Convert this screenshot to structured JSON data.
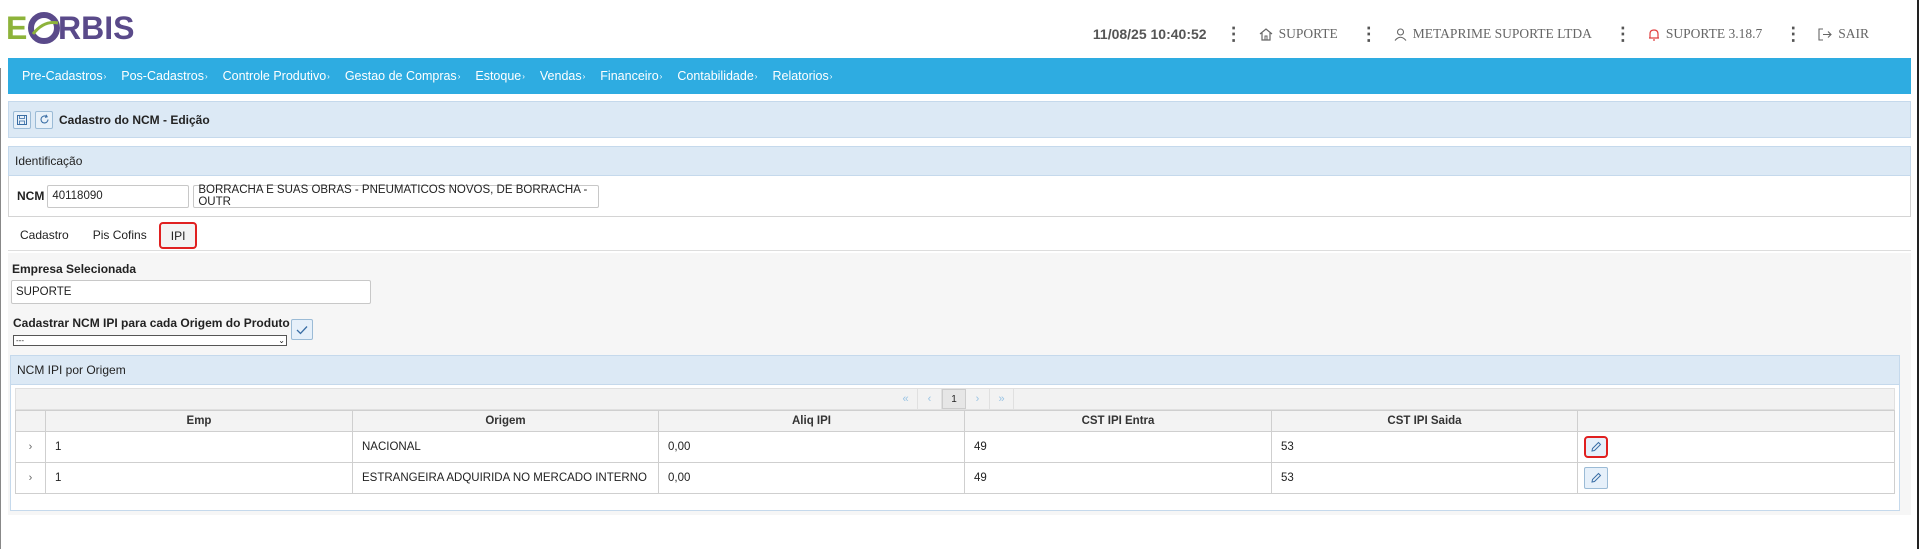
{
  "app": {
    "logo_text": "EORBIS",
    "colors": {
      "nav": "#2eace1",
      "panel_head": "#dce9f5",
      "highlight": "#e02020",
      "logo_green": "#8db33a",
      "logo_purple": "#5a4a8a"
    }
  },
  "header": {
    "datetime": "11/08/25 10:40:52",
    "company_short": "SUPORTE",
    "company_name": "METAPRIME SUPORTE LTDA",
    "version": "SUPORTE 3.18.7",
    "logout": "SAIR",
    "icons": [
      "home-icon",
      "user-icon",
      "bell-icon",
      "logout-icon"
    ]
  },
  "nav": {
    "items": [
      {
        "label": "Pre-Cadastros"
      },
      {
        "label": "Pos-Cadastros"
      },
      {
        "label": "Controle Produtivo"
      },
      {
        "label": "Gestao de Compras"
      },
      {
        "label": "Estoque"
      },
      {
        "label": "Vendas"
      },
      {
        "label": "Financeiro"
      },
      {
        "label": "Contabilidade"
      },
      {
        "label": "Relatorios"
      }
    ]
  },
  "edit": {
    "title": "Cadastro do NCM - Edição",
    "icons": [
      "save-icon",
      "refresh-icon"
    ]
  },
  "identificacao": {
    "title": "Identificação",
    "ncm_label": "NCM",
    "ncm_code": "40118090",
    "ncm_desc": "BORRACHA E SUAS OBRAS - PNEUMATICOS NOVOS, DE BORRACHA - OUTR"
  },
  "tabs": [
    {
      "label": "Cadastro",
      "active": false
    },
    {
      "label": "Pis Cofins",
      "active": false
    },
    {
      "label": "IPI",
      "active": true
    }
  ],
  "ipi": {
    "empresa_label": "Empresa Selecionada",
    "empresa_value": "SUPORTE",
    "cadastrar_label": "Cadastrar NCM IPI para cada Origem do Produto",
    "select_value": "---",
    "panel_title": "NCM IPI por Origem",
    "pager": {
      "first": "«",
      "prev": "‹",
      "page": "1",
      "next": "›",
      "last": "»"
    },
    "columns": [
      "Emp",
      "Origem",
      "Aliq IPI",
      "CST IPI Entra",
      "CST IPI Saida"
    ],
    "rows": [
      {
        "emp": "1",
        "origem": "NACIONAL",
        "aliq": "0,00",
        "cst_entra": "49",
        "cst_saida": "53"
      },
      {
        "emp": "1",
        "origem": "ESTRANGEIRA ADQUIRIDA NO MERCADO INTERNO",
        "aliq": "0,00",
        "cst_entra": "49",
        "cst_saida": "53"
      }
    ]
  }
}
